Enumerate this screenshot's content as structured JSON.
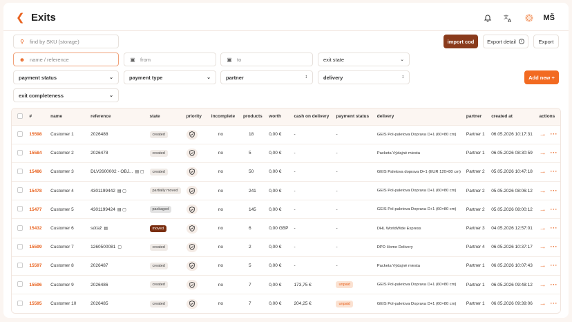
{
  "header": {
    "title": "Exits",
    "back_icon": "arrow-left-icon",
    "icons": [
      "bell-icon",
      "translate-icon",
      "loader-icon"
    ],
    "user_initials": "MŠ"
  },
  "filters": {
    "sku_placeholder": "find by SKU (storage)",
    "name_placeholder": "name / reference",
    "from_placeholder": "from",
    "to_placeholder": "to",
    "exit_state": "exit state",
    "payment_status": "payment status",
    "payment_type": "payment type",
    "partner": "partner",
    "delivery": "delivery",
    "exit_completeness": "exit completeness"
  },
  "actions": {
    "import_cod": "import cod",
    "export_detail": "Export detail",
    "export": "Export",
    "add_new": "Add new +"
  },
  "colors": {
    "accent": "#e8601c",
    "import_bg": "#8a3b1c",
    "add_bg": "#f26a21",
    "moved_badge": "#7a2e10"
  },
  "table": {
    "columns": [
      "#",
      "name",
      "reference",
      "state",
      "priority",
      "incomplete",
      "products",
      "worth",
      "cash on delivery",
      "payment status",
      "delivery",
      "partner",
      "created at",
      "actions"
    ],
    "rows": [
      {
        "id": "15598",
        "name": "Customer 1",
        "reference": "2026488",
        "ref_icons": "",
        "state": "created",
        "state_style": "",
        "incomplete": "no",
        "products": "18",
        "worth": "0,00 €",
        "cod": "-",
        "payment_status": "-",
        "delivery": "GEIS Pol-paletova Doprava D+1 (60×80 cm)",
        "partner": "Partner 1",
        "created_at": "06.05.2026 10:17:31"
      },
      {
        "id": "15584",
        "name": "Customer 2",
        "reference": "2026478",
        "ref_icons": "",
        "state": "created",
        "state_style": "",
        "incomplete": "no",
        "products": "5",
        "worth": "0,00 €",
        "cod": "-",
        "payment_status": "-",
        "delivery": "Packeta Výdajné miesta",
        "partner": "Partner 1",
        "created_at": "06.05.2026 08:30:59"
      },
      {
        "id": "15486",
        "name": "Customer 3",
        "reference": "DLV2600002 - OBJ...",
        "ref_icons": "▤ ▢",
        "state": "created",
        "state_style": "",
        "incomplete": "no",
        "products": "50",
        "worth": "0,00 €",
        "cod": "-",
        "payment_status": "-",
        "delivery": "GEIS Paletova doprava D+1 (EUR 120×80 cm)",
        "partner": "Partner 2",
        "created_at": "05.05.2026 10:47:18"
      },
      {
        "id": "15478",
        "name": "Customer 4",
        "reference": "4301199442",
        "ref_icons": "▤ ▢",
        "state": "partially moved",
        "state_style": "",
        "incomplete": "no",
        "products": "241",
        "worth": "0,00 €",
        "cod": "-",
        "payment_status": "-",
        "delivery": "GEIS Pol-paletova Doprava D+1 (60×80 cm)",
        "partner": "Partner 2",
        "created_at": "05.05.2026 08:06:12"
      },
      {
        "id": "15477",
        "name": "Customer 5",
        "reference": "4301199424",
        "ref_icons": "▤ ▢",
        "state": "packaged",
        "state_style": "packaged",
        "incomplete": "no",
        "products": "145",
        "worth": "0,00 €",
        "cod": "-",
        "payment_status": "-",
        "delivery": "GEIS Pol-paletova Doprava D+1 (60×80 cm)",
        "partner": "Partner 2",
        "created_at": "05.05.2026 08:00:12"
      },
      {
        "id": "15432",
        "name": "Customer 6",
        "reference": "súťaž",
        "ref_icons": "▤",
        "state": "moved",
        "state_style": "moved",
        "incomplete": "no",
        "products": "6",
        "worth": "0,00 GBP",
        "cod": "-",
        "payment_status": "-",
        "delivery": "DHL WorldWide Express",
        "partner": "Partner 3",
        "created_at": "04.05.2026 12:57:01"
      },
      {
        "id": "15599",
        "name": "Customer 7",
        "reference": "1260500081",
        "ref_icons": "▢",
        "state": "created",
        "state_style": "",
        "incomplete": "no",
        "products": "2",
        "worth": "0,00 €",
        "cod": "-",
        "payment_status": "-",
        "delivery": "DPD Home Delivery",
        "partner": "Partner 4",
        "created_at": "06.05.2026 10:37:17"
      },
      {
        "id": "15597",
        "name": "Customer 8",
        "reference": "2026487",
        "ref_icons": "",
        "state": "created",
        "state_style": "",
        "incomplete": "no",
        "products": "5",
        "worth": "0,00 €",
        "cod": "-",
        "payment_status": "-",
        "delivery": "Packeta Výdajné miesta",
        "partner": "Partner 1",
        "created_at": "06.05.2026 10:07:43"
      },
      {
        "id": "15596",
        "name": "Customer 9",
        "reference": "2026486",
        "ref_icons": "",
        "state": "created",
        "state_style": "",
        "incomplete": "no",
        "products": "7",
        "worth": "0,00 €",
        "cod": "173,75 €",
        "payment_status": "unpaid",
        "delivery": "GEIS Pol-paletova Doprava D+1 (60×80 cm)",
        "partner": "Partner 1",
        "created_at": "06.05.2026 09:48:12"
      },
      {
        "id": "15595",
        "name": "Customer 10",
        "reference": "2026485",
        "ref_icons": "",
        "state": "created",
        "state_style": "",
        "incomplete": "no",
        "products": "7",
        "worth": "0,00 €",
        "cod": "204,25 €",
        "payment_status": "unpaid",
        "delivery": "GEIS Pol-paletova Doprava D+1 (60×80 cm)",
        "partner": "Partner 1",
        "created_at": "06.05.2026 09:39:06"
      }
    ]
  }
}
